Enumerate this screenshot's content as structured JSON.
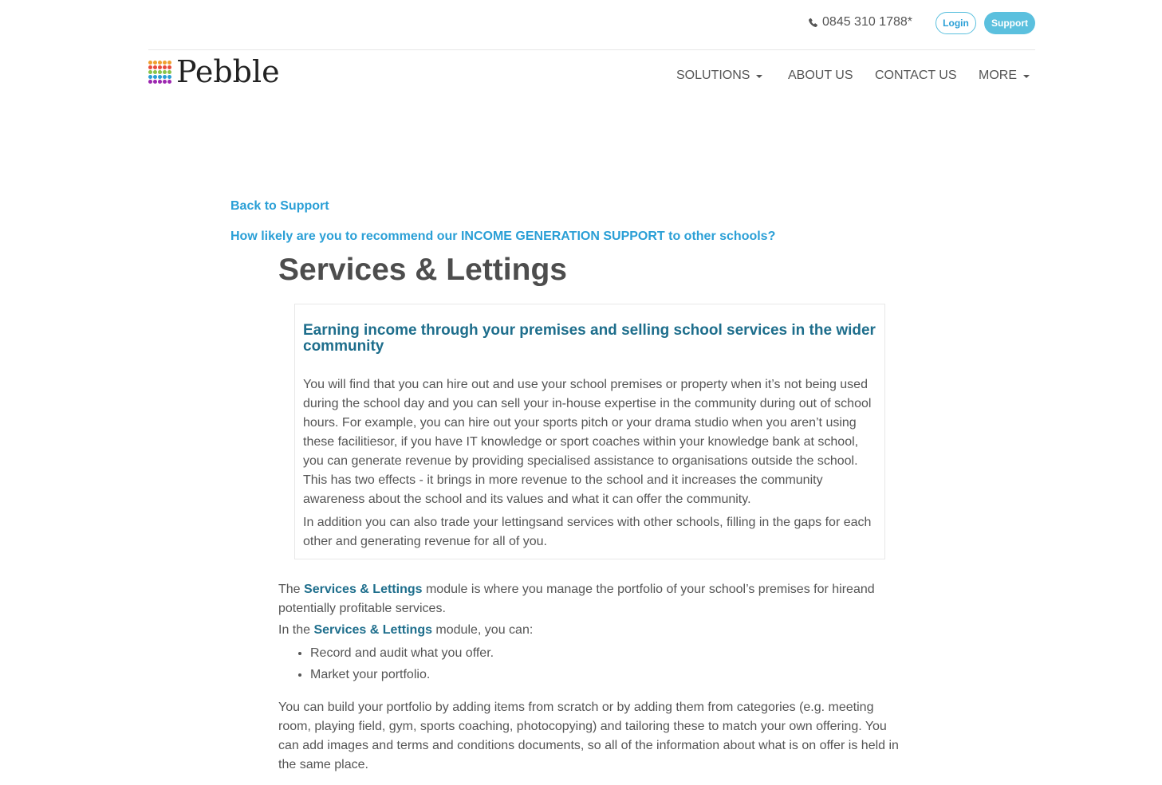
{
  "header": {
    "phone": "0845 310 1788*",
    "login_label": "Login",
    "support_label": "Support",
    "logo_text": "Pebble"
  },
  "nav": {
    "items": [
      {
        "label": "SOLUTIONS",
        "dropdown": true
      },
      {
        "label": "ABOUT US",
        "dropdown": false
      },
      {
        "label": "CONTACT US",
        "dropdown": false
      },
      {
        "label": "MORE",
        "dropdown": true
      }
    ]
  },
  "content": {
    "back_link": "Back to Support",
    "survey_link": "How likely are you to recommend our INCOME GENERATION SUPPORT to other schools?",
    "title": "Services & Lettings",
    "intro": {
      "heading": "Earning income through your premises and selling school services in the wider community",
      "paragraph1": "You will find that you can hire out and use your school premises or property when it’s not being used during the school day and you can sell your in-house expertise in the community during out of school hours. For example, you can hire out your sports pitch or your drama studio when you aren’t using these facilitiesor, if you have IT knowledge or sport coaches within your knowledge bank at school, you can generate revenue by providing specialised assistance to organisations outside the school. This has two effects - it brings in more revenue to the school and it increases the community awareness about the school and its values and what it can offer the community.",
      "paragraph2": "In addition you can also trade your lettingsand services with other schools, filling in the gaps for each other and generating revenue for all of you."
    },
    "module_para": {
      "prefix": "The ",
      "highlight": "Services & Lettings",
      "suffix": " module is where you manage the portfolio of your school’s premises for hireand potentially profitable services."
    },
    "in_module": {
      "prefix": "In the ",
      "highlight": "Services & Lettings",
      "suffix": " module, you can:"
    },
    "features": [
      "Record and audit what you offer.",
      "Market your portfolio."
    ],
    "portfolio_para": "You can build your portfolio by adding items from scratch or by adding them from categories (e.g. meeting room, playing field, gym, sports coaching, photocopying) and tailoring these to match your own offering. You can add images and terms and conditions documents, so all of the information about what is on offer is held in the same place."
  },
  "colors": {
    "accent_link": "#2a9fd6",
    "heading_teal": "#1e6e8c",
    "support_button": "#5bc0de",
    "logo_dots": [
      "#f0a030",
      "#e84c3d",
      "#8bc34a",
      "#2a9fd6",
      "#9c27b0"
    ]
  },
  "icons": {
    "phone": "phone-icon",
    "caret": "caret-down-icon",
    "logo": "pebble-dots-logo-icon"
  }
}
